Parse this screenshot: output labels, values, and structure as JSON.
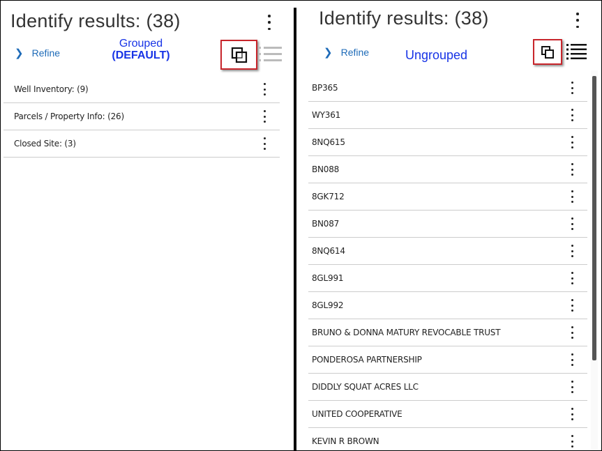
{
  "left": {
    "title": "Identify results: (38)",
    "refine_label": "Refine",
    "annotation_line1": "Grouped",
    "annotation_line2": "(DEFAULT)",
    "groups": [
      "Well Inventory: (9)",
      "Parcels / Property Info: (26)",
      "Closed Site: (3)"
    ]
  },
  "right": {
    "title": "Identify results: (38)",
    "refine_label": "Refine",
    "annotation": "Ungrouped",
    "items": [
      "BP365",
      "WY361",
      "8NQ615",
      "BN088",
      "8GK712",
      "BN087",
      "8NQ614",
      "8GL991",
      "8GL992",
      "BRUNO & DONNA MATURY REVOCABLE TRUST",
      "PONDEROSA PARTNERSHIP",
      "DIDDLY SQUAT ACRES LLC",
      "UNITED COOPERATIVE",
      "KEVIN R BROWN"
    ]
  },
  "icons": {
    "grouped_toggle": "group-toggle-icon",
    "ungrouped_toggle": "ungroup-toggle-icon",
    "list_view": "list-view-icon",
    "more": "more-vertical-icon",
    "refine_chevron": "chevron-right-icon"
  },
  "colors": {
    "annotation_blue": "#1733e6",
    "refine_blue": "#1e6bb8",
    "highlight_red": "#c8252b"
  }
}
